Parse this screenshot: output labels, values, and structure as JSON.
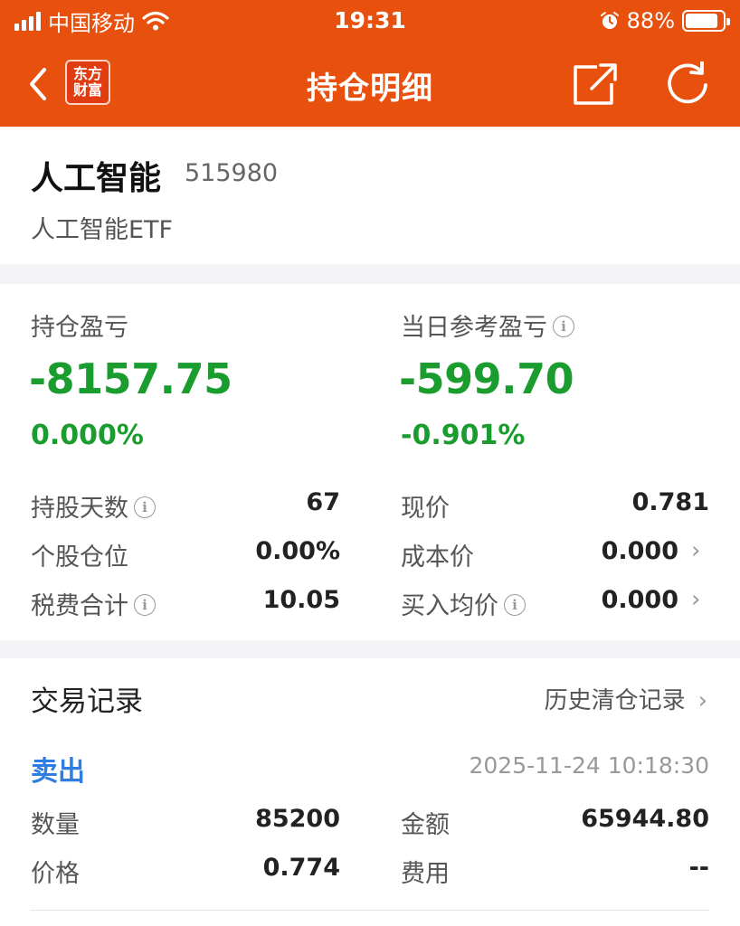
{
  "status_bar": {
    "carrier": "中国移动",
    "time": "19:31",
    "battery_pct": "88%",
    "battery_level": 0.88
  },
  "nav": {
    "title": "持仓明细",
    "logo_line1": "东方",
    "logo_line2": "财富",
    "icons": [
      "back-icon",
      "share-icon",
      "refresh-icon"
    ]
  },
  "fund": {
    "name": "人工智能",
    "code": "515980",
    "full_name": "人工智能ETF"
  },
  "pnl": {
    "holding_label": "持仓盈亏",
    "holding_value": "-8157.75",
    "holding_pct": "0.000%",
    "daily_label": "当日参考盈亏",
    "daily_value": "-599.70",
    "daily_pct": "-0.901%",
    "loss_color": "#1a9d2e"
  },
  "details": {
    "days_label": "持股天数",
    "days_value": "67",
    "position_label": "个股仓位",
    "position_value": "0.00%",
    "fees_label": "税费合计",
    "fees_value": "10.05",
    "price_label": "现价",
    "price_value": "0.781",
    "cost_label": "成本价",
    "cost_value": "0.000",
    "avg_label": "买入均价",
    "avg_value": "0.000"
  },
  "trades": {
    "title": "交易记录",
    "history_link": "历史清仓记录",
    "record": {
      "type": "卖出",
      "time": "2025-11-24 10:18:30",
      "qty_label": "数量",
      "qty_value": "85200",
      "amount_label": "金额",
      "amount_value": "65944.80",
      "price_label": "价格",
      "price_value": "0.774",
      "fee_label": "费用",
      "fee_value": "--"
    }
  },
  "colors": {
    "brand": "#e8500e",
    "buy_sell_blue": "#2f7de1"
  }
}
